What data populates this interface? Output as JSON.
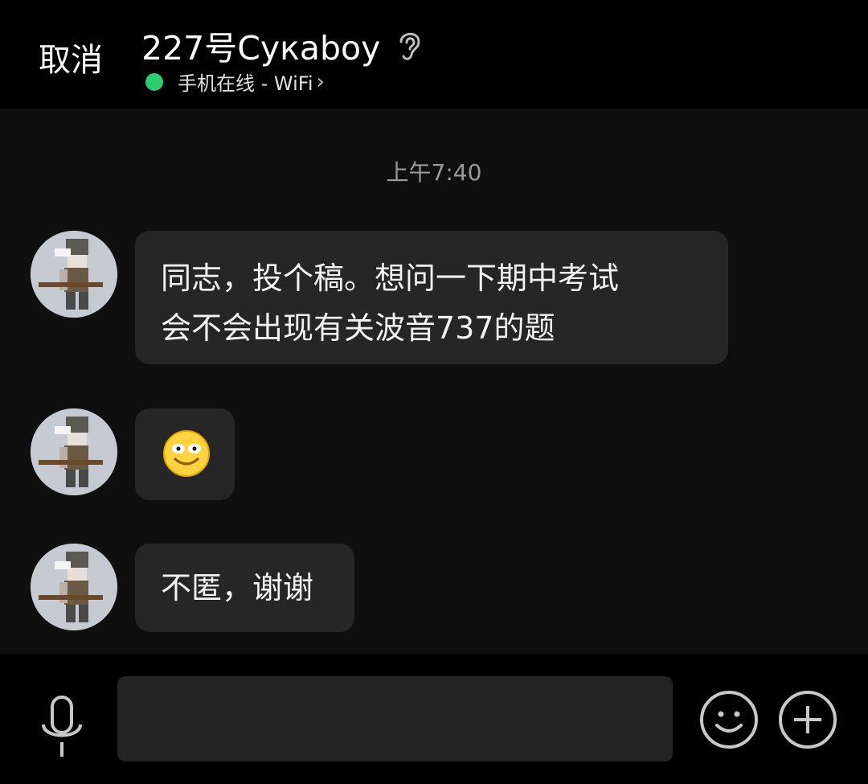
{
  "header": {
    "cancel_label": "取消",
    "title": "227号Cyкaboy",
    "status_text": "手机在线 - WiFi",
    "status_chevron": "›",
    "icons": {
      "ear": "ear-icon",
      "online": "online-dot"
    },
    "colors": {
      "online": "#2ecc71"
    }
  },
  "chat": {
    "timestamp": "上午7:40",
    "messages": [
      {
        "text": "同志，投个稿。想问一下期中考试\n会不会出现有关波音737的题"
      },
      {
        "text": "",
        "emoji": "grin-emoji"
      },
      {
        "text": "不匿，谢谢"
      }
    ]
  },
  "composer": {
    "input_value": "",
    "input_placeholder": "",
    "icons": [
      "microphone-icon",
      "smiley-icon",
      "plus-icon"
    ]
  }
}
